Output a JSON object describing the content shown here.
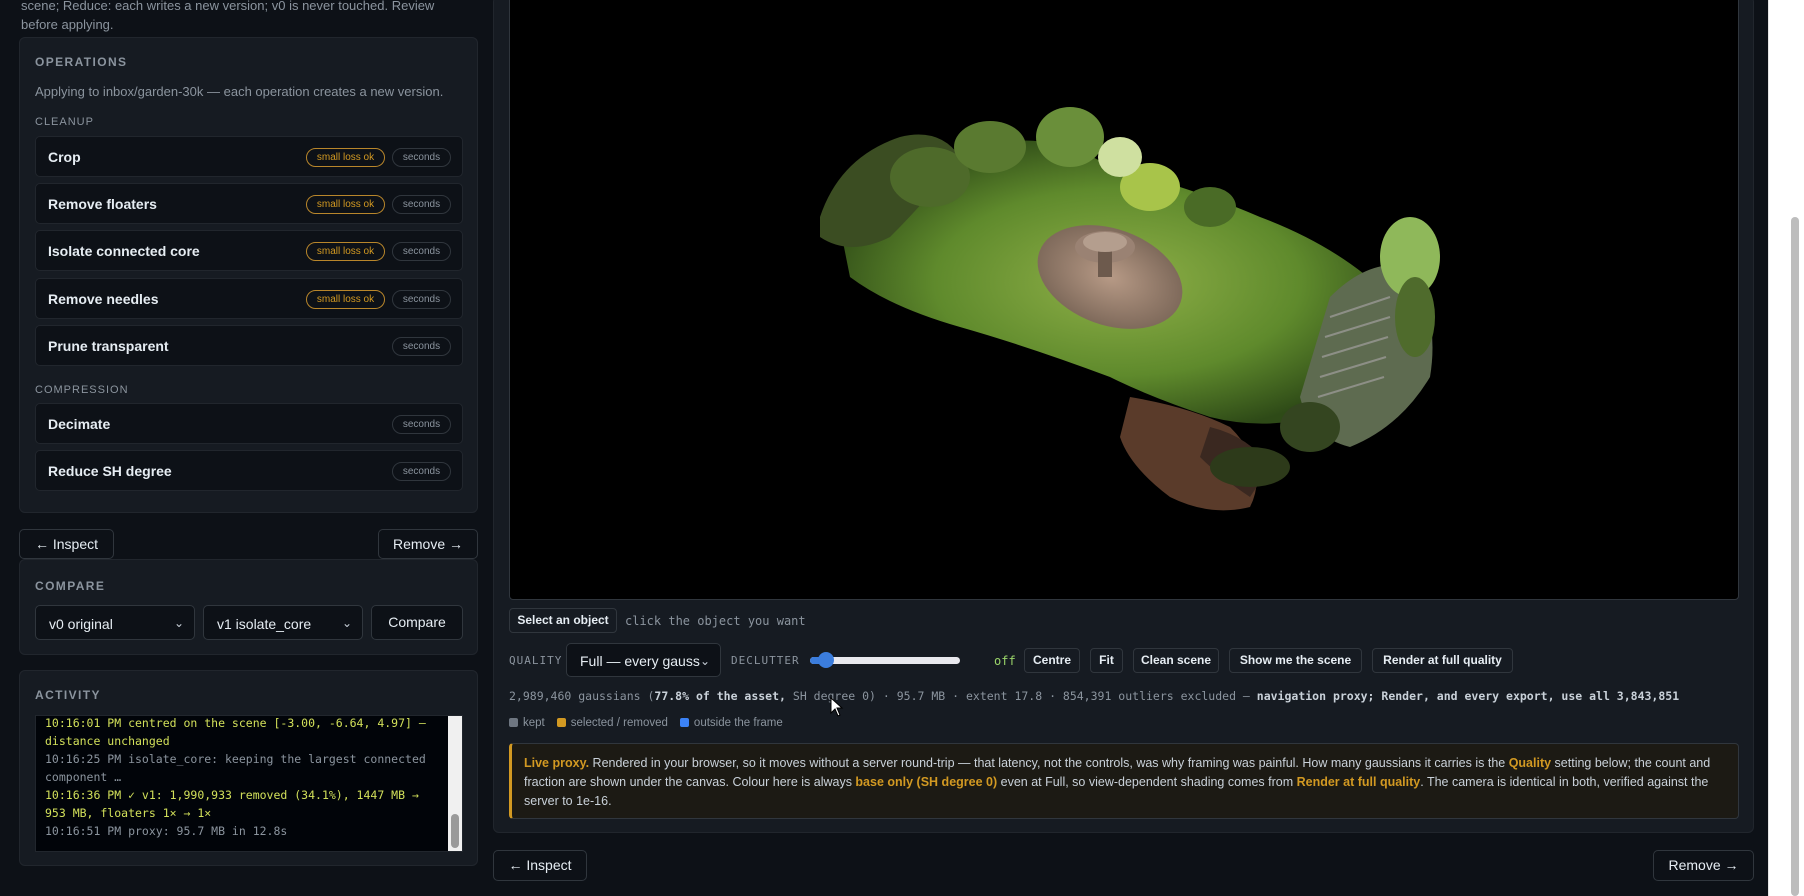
{
  "intro": {
    "line1": "scene; Reduce: each writes a new version; v0 is never touched. Review",
    "line2": "before applying."
  },
  "operations": {
    "title": "OPERATIONS",
    "subtitle": "Applying to inbox/garden-30k — each operation creates a new version.",
    "cleanup_label": "CLEANUP",
    "compression_label": "COMPRESSION",
    "tag_loss": "small loss ok",
    "tag_seconds": "seconds",
    "items": [
      {
        "label": "Crop"
      },
      {
        "label": "Remove floaters"
      },
      {
        "label": "Isolate connected core"
      },
      {
        "label": "Remove needles"
      },
      {
        "label": "Prune transparent"
      },
      {
        "label": "Decimate"
      },
      {
        "label": "Reduce SH degree"
      }
    ]
  },
  "nav": {
    "back": "← Inspect",
    "next": "Remove →"
  },
  "compare": {
    "title": "COMPARE",
    "left_value": "v0 original",
    "right_value": "v1 isolate_core",
    "button": "Compare"
  },
  "activity": {
    "title": "ACTIVITY",
    "lines": [
      "10:16:01 PM  centred on the scene [-3.00, -6.64, 4.97] —",
      "distance unchanged",
      "10:16:25 PM  isolate_core: keeping the largest connected",
      "component …",
      "10:16:36 PM  ✓ v1: 1,990,933 removed (34.1%), 1447 MB →",
      "953 MB, floaters 1× → 1×",
      "10:16:51 PM  proxy: 95.7 MB in 12.8s"
    ]
  },
  "viewer": {
    "select_button": "Select an object",
    "hint": "click the object you want",
    "quality_label": "QUALITY",
    "quality_value": "Full — every gauss",
    "declutter_label": "DECLUTTER",
    "declutter_level": 0.05,
    "declutter_value": "off",
    "buttons": {
      "centre": "Centre",
      "fit": "Fit",
      "clean": "Clean scene",
      "show": "Show me the scene",
      "render": "Render at full quality"
    },
    "stats": {
      "a": "2,989,460 gaussians (",
      "b": "77.8% of the asset,",
      "c": " SH degree 0) · 95.7 MB · extent 17.8 · 854,391 outliers excluded — ",
      "d": "navigation proxy; Render, and every export, use all 3,843,851"
    },
    "legend": {
      "kept": "kept",
      "selected": "selected / removed",
      "outside": "outside the frame",
      "kept_color": "#6e7681",
      "selected_color": "#d29922",
      "outside_color": "#3b82f6"
    },
    "note": {
      "t1": "Live proxy.",
      "t2": " Rendered in your browser, so it moves without a server round-trip — that latency, not the controls, was why framing was painful. How many gaussians it carries is the ",
      "t3": "Quality",
      "t4": " setting below; the count and fraction are shown under the canvas. Colour here is always ",
      "t5": "base only (SH degree 0)",
      "t6": " even at Full, so view-dependent shading comes from ",
      "t7": "Render at full quality",
      "t8": ". The camera is identical in both, verified against the server to 1e-16."
    }
  }
}
